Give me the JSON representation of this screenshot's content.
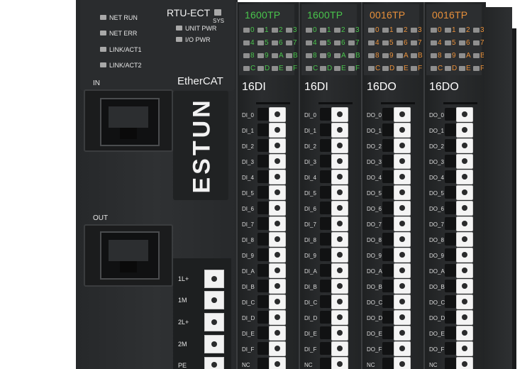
{
  "coupler": {
    "model": "RTU-ECT",
    "sys_label": "SYS",
    "status_leds": [
      "NET RUN",
      "NET ERR",
      "LINK/ACT1",
      "LINK/ACT2"
    ],
    "power_leds": [
      "UNIT PWR",
      "I/O PWR"
    ],
    "protocol": "EtherCAT",
    "brand": "ESTUN",
    "port_in_label": "IN",
    "port_out_label": "OUT",
    "power_terminals": [
      "1L+",
      "1M",
      "2L+",
      "2M",
      "PE"
    ]
  },
  "modules": [
    {
      "model": "1600TP",
      "type": "16DI",
      "accent": "#49c44c",
      "channel_prefix": "DI"
    },
    {
      "model": "1600TP",
      "type": "16DI",
      "accent": "#49c44c",
      "channel_prefix": "DI"
    },
    {
      "model": "0016TP",
      "type": "16DO",
      "accent": "#e8903a",
      "channel_prefix": "DO"
    },
    {
      "model": "0016TP",
      "type": "16DO",
      "accent": "#e8903a",
      "channel_prefix": "DO"
    }
  ],
  "led_rows": [
    [
      "0",
      "1",
      "2",
      "3"
    ],
    [
      "4",
      "5",
      "6",
      "7"
    ],
    [
      "8",
      "9",
      "A",
      "B"
    ],
    [
      "C",
      "D",
      "E",
      "F"
    ]
  ],
  "channels": [
    "_0",
    "_1",
    "_2",
    "_3",
    "_4",
    "_5",
    "_6",
    "_7",
    "_8",
    "_9",
    "_A",
    "_B",
    "_C",
    "_D",
    "_E",
    "_F",
    "NC"
  ],
  "colors": {
    "housing": "#2a2c2e",
    "terminal": "#f4f4f4",
    "led_off": "#a9a9a9"
  }
}
